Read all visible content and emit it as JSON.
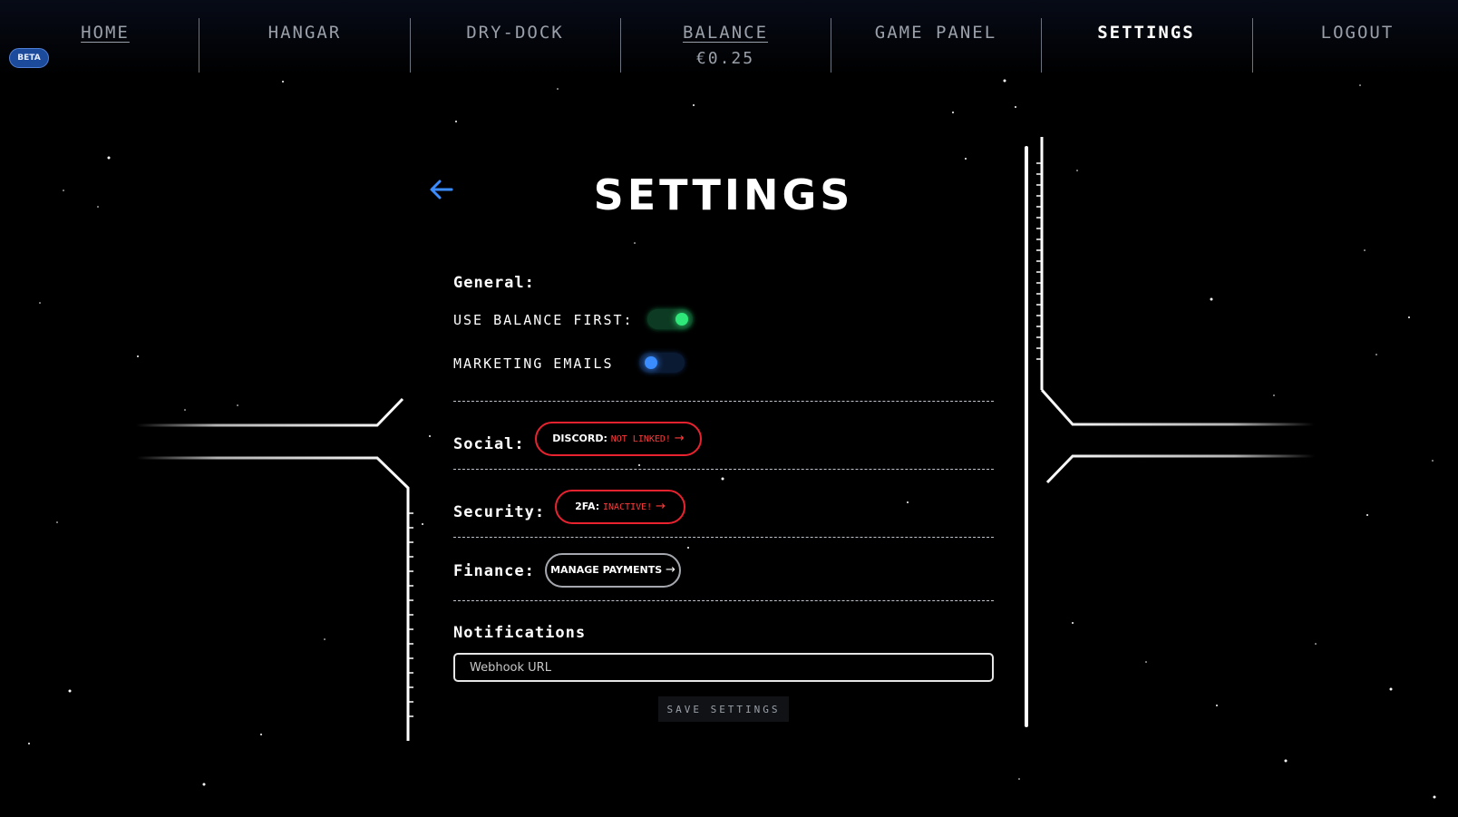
{
  "nav": {
    "home": "HOME",
    "hangar": "HANGAR",
    "dry_dock": "DRY-DOCK",
    "balance": "BALANCE",
    "balance_value": "€0.25",
    "game_panel": "GAME PANEL",
    "settings": "SETTINGS",
    "logout": "LOGOUT"
  },
  "badge": {
    "beta": "BETA"
  },
  "page": {
    "title": "SETTINGS"
  },
  "general": {
    "heading": "General:",
    "use_balance_label": "USE BALANCE FIRST:",
    "use_balance_on": true,
    "marketing_label": "MARKETING EMAILS",
    "marketing_on": false
  },
  "social": {
    "heading": "Social:",
    "discord_key": "DISCORD:",
    "discord_status": "NOT LINKED!",
    "arrow": "→"
  },
  "security": {
    "heading": "Security:",
    "twofa_key": "2FA:",
    "twofa_status": "INACTIVE!",
    "arrow": "→"
  },
  "finance": {
    "heading": "Finance:",
    "manage_label": "MANAGE PAYMENTS",
    "arrow": "→"
  },
  "notifications": {
    "heading": "Notifications",
    "webhook_placeholder": "Webhook URL",
    "webhook_value": ""
  },
  "actions": {
    "save_label": "SAVE SETTINGS"
  },
  "icons": {
    "back": "arrow-left-icon"
  },
  "colors": {
    "accent_blue": "#2f8fd8",
    "toggle_on": "#2ee879",
    "toggle_off": "#3a8cff",
    "alert_red": "#e8222e",
    "text": "#ffffff",
    "muted": "#9aa0a9"
  }
}
